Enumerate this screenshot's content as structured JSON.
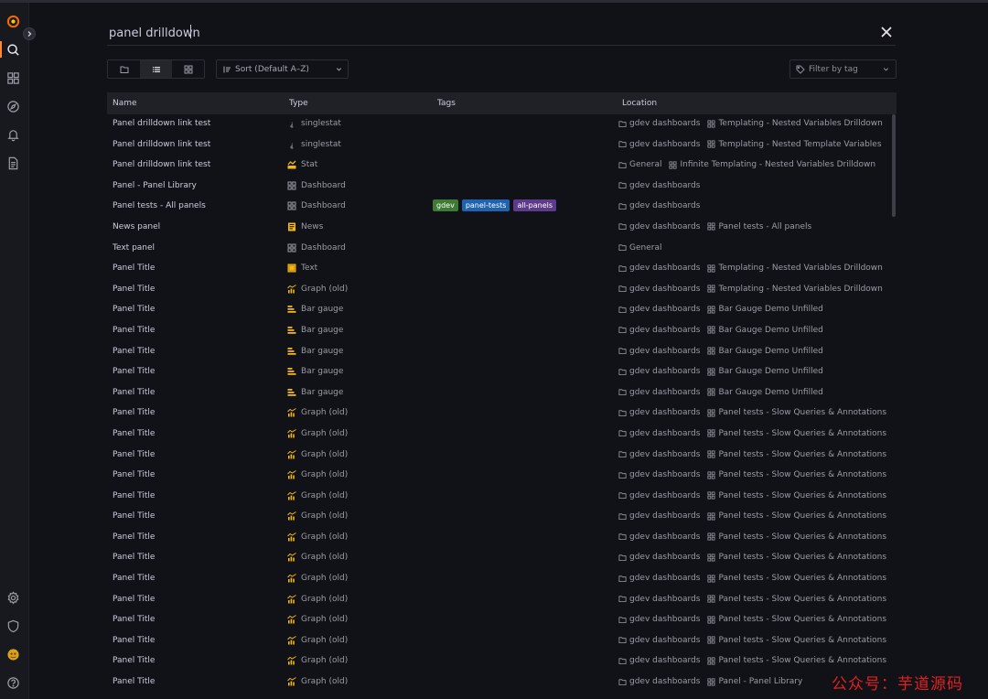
{
  "search": {
    "value": "panel drilldown"
  },
  "sort": {
    "label": "Sort (Default A–Z)"
  },
  "tag_filter": {
    "placeholder": "Filter by tag"
  },
  "table": {
    "headers": {
      "name": "Name",
      "type": "Type",
      "tags": "Tags",
      "location": "Location"
    }
  },
  "rows": [
    {
      "name": "Panel drilldown link test",
      "type": "singlestat",
      "type_icon": "singlestat-icon",
      "tags": [],
      "folder": "gdev dashboards",
      "dashboard": "Templating - Nested Variables Drilldown"
    },
    {
      "name": "Panel drilldown link test",
      "type": "singlestat",
      "type_icon": "singlestat-icon",
      "tags": [],
      "folder": "gdev dashboards",
      "dashboard": "Templating - Nested Template Variables"
    },
    {
      "name": "Panel drilldown link test",
      "type": "Stat",
      "type_icon": "stat-icon",
      "tags": [],
      "folder": "General",
      "dashboard": "Infinite Templating - Nested Variables Drilldown"
    },
    {
      "name": "Panel - Panel Library",
      "type": "Dashboard",
      "type_icon": "dashboard-icon",
      "tags": [],
      "folder": "gdev dashboards",
      "dashboard": ""
    },
    {
      "name": "Panel tests - All panels",
      "type": "Dashboard",
      "type_icon": "dashboard-icon",
      "tags": [
        {
          "label": "gdev",
          "color": "#3d7a33"
        },
        {
          "label": "panel-tests",
          "color": "#1f62b0"
        },
        {
          "label": "all-panels",
          "color": "#5e3b8a"
        }
      ],
      "folder": "gdev dashboards",
      "dashboard": ""
    },
    {
      "name": "News panel",
      "type": "News",
      "type_icon": "news-icon",
      "tags": [],
      "folder": "gdev dashboards",
      "dashboard": "Panel tests - All panels"
    },
    {
      "name": "Text panel",
      "type": "Dashboard",
      "type_icon": "dashboard-icon",
      "tags": [],
      "folder": "General",
      "dashboard": ""
    },
    {
      "name": "Panel Title",
      "type": "Text",
      "type_icon": "text-icon",
      "tags": [],
      "folder": "gdev dashboards",
      "dashboard": "Templating - Nested Variables Drilldown"
    },
    {
      "name": "Panel Title",
      "type": "Graph (old)",
      "type_icon": "graph-icon",
      "tags": [],
      "folder": "gdev dashboards",
      "dashboard": "Templating - Nested Variables Drilldown"
    },
    {
      "name": "Panel Title",
      "type": "Bar gauge",
      "type_icon": "bar-gauge-icon",
      "tags": [],
      "folder": "gdev dashboards",
      "dashboard": "Bar Gauge Demo Unfilled"
    },
    {
      "name": "Panel Title",
      "type": "Bar gauge",
      "type_icon": "bar-gauge-icon",
      "tags": [],
      "folder": "gdev dashboards",
      "dashboard": "Bar Gauge Demo Unfilled"
    },
    {
      "name": "Panel Title",
      "type": "Bar gauge",
      "type_icon": "bar-gauge-icon",
      "tags": [],
      "folder": "gdev dashboards",
      "dashboard": "Bar Gauge Demo Unfilled"
    },
    {
      "name": "Panel Title",
      "type": "Bar gauge",
      "type_icon": "bar-gauge-icon",
      "tags": [],
      "folder": "gdev dashboards",
      "dashboard": "Bar Gauge Demo Unfilled"
    },
    {
      "name": "Panel Title",
      "type": "Bar gauge",
      "type_icon": "bar-gauge-icon",
      "tags": [],
      "folder": "gdev dashboards",
      "dashboard": "Bar Gauge Demo Unfilled"
    },
    {
      "name": "Panel Title",
      "type": "Graph (old)",
      "type_icon": "graph-icon",
      "tags": [],
      "folder": "gdev dashboards",
      "dashboard": "Panel tests - Slow Queries & Annotations"
    },
    {
      "name": "Panel Title",
      "type": "Graph (old)",
      "type_icon": "graph-icon",
      "tags": [],
      "folder": "gdev dashboards",
      "dashboard": "Panel tests - Slow Queries & Annotations"
    },
    {
      "name": "Panel Title",
      "type": "Graph (old)",
      "type_icon": "graph-icon",
      "tags": [],
      "folder": "gdev dashboards",
      "dashboard": "Panel tests - Slow Queries & Annotations"
    },
    {
      "name": "Panel Title",
      "type": "Graph (old)",
      "type_icon": "graph-icon",
      "tags": [],
      "folder": "gdev dashboards",
      "dashboard": "Panel tests - Slow Queries & Annotations"
    },
    {
      "name": "Panel Title",
      "type": "Graph (old)",
      "type_icon": "graph-icon",
      "tags": [],
      "folder": "gdev dashboards",
      "dashboard": "Panel tests - Slow Queries & Annotations"
    },
    {
      "name": "Panel Title",
      "type": "Graph (old)",
      "type_icon": "graph-icon",
      "tags": [],
      "folder": "gdev dashboards",
      "dashboard": "Panel tests - Slow Queries & Annotations"
    },
    {
      "name": "Panel Title",
      "type": "Graph (old)",
      "type_icon": "graph-icon",
      "tags": [],
      "folder": "gdev dashboards",
      "dashboard": "Panel tests - Slow Queries & Annotations"
    },
    {
      "name": "Panel Title",
      "type": "Graph (old)",
      "type_icon": "graph-icon",
      "tags": [],
      "folder": "gdev dashboards",
      "dashboard": "Panel tests - Slow Queries & Annotations"
    },
    {
      "name": "Panel Title",
      "type": "Graph (old)",
      "type_icon": "graph-icon",
      "tags": [],
      "folder": "gdev dashboards",
      "dashboard": "Panel tests - Slow Queries & Annotations"
    },
    {
      "name": "Panel Title",
      "type": "Graph (old)",
      "type_icon": "graph-icon",
      "tags": [],
      "folder": "gdev dashboards",
      "dashboard": "Panel tests - Slow Queries & Annotations"
    },
    {
      "name": "Panel Title",
      "type": "Graph (old)",
      "type_icon": "graph-icon",
      "tags": [],
      "folder": "gdev dashboards",
      "dashboard": "Panel tests - Slow Queries & Annotations"
    },
    {
      "name": "Panel Title",
      "type": "Graph (old)",
      "type_icon": "graph-icon",
      "tags": [],
      "folder": "gdev dashboards",
      "dashboard": "Panel tests - Slow Queries & Annotations"
    },
    {
      "name": "Panel Title",
      "type": "Graph (old)",
      "type_icon": "graph-icon",
      "tags": [],
      "folder": "gdev dashboards",
      "dashboard": "Panel tests - Slow Queries & Annotations"
    },
    {
      "name": "Panel Title",
      "type": "Graph (old)",
      "type_icon": "graph-icon",
      "tags": [],
      "folder": "gdev dashboards",
      "dashboard": "Panel - Panel Library"
    }
  ],
  "watermark": "公众号：芋道源码",
  "colors": {
    "accent": "#ff8833",
    "icon_yellow": "#f2b616",
    "background": "#111217"
  }
}
